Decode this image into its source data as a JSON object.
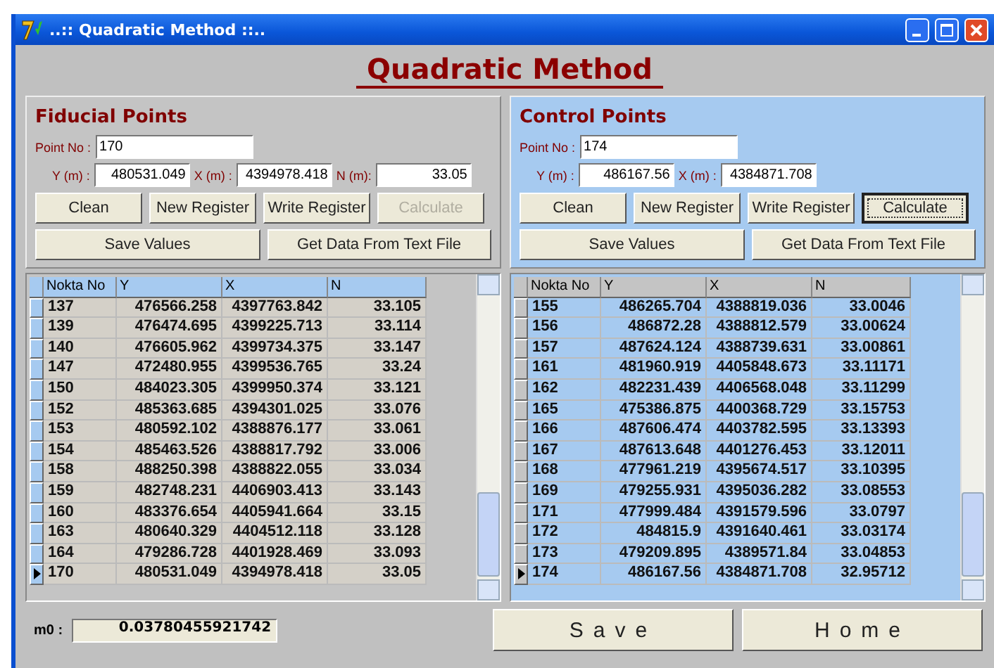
{
  "window": {
    "title": "..:: Quadratic Method ::.."
  },
  "heading": "Quadratic Method",
  "panels": [
    {
      "title": "Fiducial Points",
      "color": "#c4c4c4",
      "point_no_label": "Point No :",
      "point_no": "170",
      "fields": [
        {
          "label": "Y (m) :",
          "value": "480531.049"
        },
        {
          "label": "X (m) :",
          "value": "4394978.418"
        },
        {
          "label": "N (m):",
          "value": "33.05"
        }
      ],
      "buttons": [
        {
          "label": "Clean",
          "disabled": false,
          "focused": false
        },
        {
          "label": "New Register",
          "disabled": false,
          "focused": false
        },
        {
          "label": "Write Register",
          "disabled": false,
          "focused": false
        },
        {
          "label": "Calculate",
          "disabled": true,
          "focused": false
        }
      ],
      "wide_buttons": [
        "Save Values",
        "Get Data From Text File"
      ],
      "grid": {
        "columns": [
          "Nokta No",
          "Y",
          "X",
          "N"
        ],
        "rows": [
          {
            "cells": [
              "137",
              "476566.258",
              "4397763.842",
              "33.105"
            ],
            "selected": false
          },
          {
            "cells": [
              "139",
              "476474.695",
              "4399225.713",
              "33.114"
            ],
            "selected": false
          },
          {
            "cells": [
              "140",
              "476605.962",
              "4399734.375",
              "33.147"
            ],
            "selected": false
          },
          {
            "cells": [
              "147",
              "472480.955",
              "4399536.765",
              "33.24"
            ],
            "selected": false
          },
          {
            "cells": [
              "150",
              "484023.305",
              "4399950.374",
              "33.121"
            ],
            "selected": false
          },
          {
            "cells": [
              "152",
              "485363.685",
              "4394301.025",
              "33.076"
            ],
            "selected": false
          },
          {
            "cells": [
              "153",
              "480592.102",
              "4388876.177",
              "33.061"
            ],
            "selected": false
          },
          {
            "cells": [
              "154",
              "485463.526",
              "4388817.792",
              "33.006"
            ],
            "selected": false
          },
          {
            "cells": [
              "158",
              "488250.398",
              "4388822.055",
              "33.034"
            ],
            "selected": false
          },
          {
            "cells": [
              "159",
              "482748.231",
              "4406903.413",
              "33.143"
            ],
            "selected": false
          },
          {
            "cells": [
              "160",
              "483376.654",
              "4405941.664",
              "33.15"
            ],
            "selected": false
          },
          {
            "cells": [
              "163",
              "480640.329",
              "4404512.118",
              "33.128"
            ],
            "selected": false
          },
          {
            "cells": [
              "164",
              "479286.728",
              "4401928.469",
              "33.093"
            ],
            "selected": false
          },
          {
            "cells": [
              "170",
              "480531.049",
              "4394978.418",
              "33.05"
            ],
            "selected": true
          }
        ]
      }
    },
    {
      "title": "Control Points",
      "color": "#a6caf0",
      "point_no_label": "Point No :",
      "point_no": "174",
      "fields": [
        {
          "label": "Y (m) :",
          "value": "486167.56"
        },
        {
          "label": "X (m) :",
          "value": "4384871.708"
        }
      ],
      "buttons": [
        {
          "label": "Clean",
          "disabled": false,
          "focused": false
        },
        {
          "label": "New Register",
          "disabled": false,
          "focused": false
        },
        {
          "label": "Write Register",
          "disabled": false,
          "focused": false
        },
        {
          "label": "Calculate",
          "disabled": false,
          "focused": true
        }
      ],
      "wide_buttons": [
        "Save Values",
        "Get Data From Text File"
      ],
      "grid": {
        "columns": [
          "Nokta No",
          "Y",
          "X",
          "N"
        ],
        "rows": [
          {
            "cells": [
              "155",
              "486265.704",
              "4388819.036",
              "33.0046"
            ],
            "selected": false
          },
          {
            "cells": [
              "156",
              "486872.28",
              "4388812.579",
              "33.00624"
            ],
            "selected": false
          },
          {
            "cells": [
              "157",
              "487624.124",
              "4388739.631",
              "33.00861"
            ],
            "selected": false
          },
          {
            "cells": [
              "161",
              "481960.919",
              "4405848.673",
              "33.11171"
            ],
            "selected": false
          },
          {
            "cells": [
              "162",
              "482231.439",
              "4406568.048",
              "33.11299"
            ],
            "selected": false
          },
          {
            "cells": [
              "165",
              "475386.875",
              "4400368.729",
              "33.15753"
            ],
            "selected": false
          },
          {
            "cells": [
              "166",
              "487606.474",
              "4403782.595",
              "33.13393"
            ],
            "selected": false
          },
          {
            "cells": [
              "167",
              "487613.648",
              "4401276.453",
              "33.12011"
            ],
            "selected": false
          },
          {
            "cells": [
              "168",
              "477961.219",
              "4395674.517",
              "33.10395"
            ],
            "selected": false
          },
          {
            "cells": [
              "169",
              "479255.931",
              "4395036.282",
              "33.08553"
            ],
            "selected": false
          },
          {
            "cells": [
              "171",
              "477999.484",
              "4391579.596",
              "33.0797"
            ],
            "selected": false
          },
          {
            "cells": [
              "172",
              "484815.9",
              "4391640.461",
              "33.03174"
            ],
            "selected": false
          },
          {
            "cells": [
              "173",
              "479209.895",
              "4389571.84",
              "33.04853"
            ],
            "selected": false
          },
          {
            "cells": [
              "174",
              "486167.56",
              "4384871.708",
              "32.95712"
            ],
            "selected": true
          }
        ]
      }
    }
  ],
  "m0": {
    "label": "m0 :",
    "value": "0.03780455921742"
  },
  "buttons": [
    "Save",
    "Home"
  ]
}
